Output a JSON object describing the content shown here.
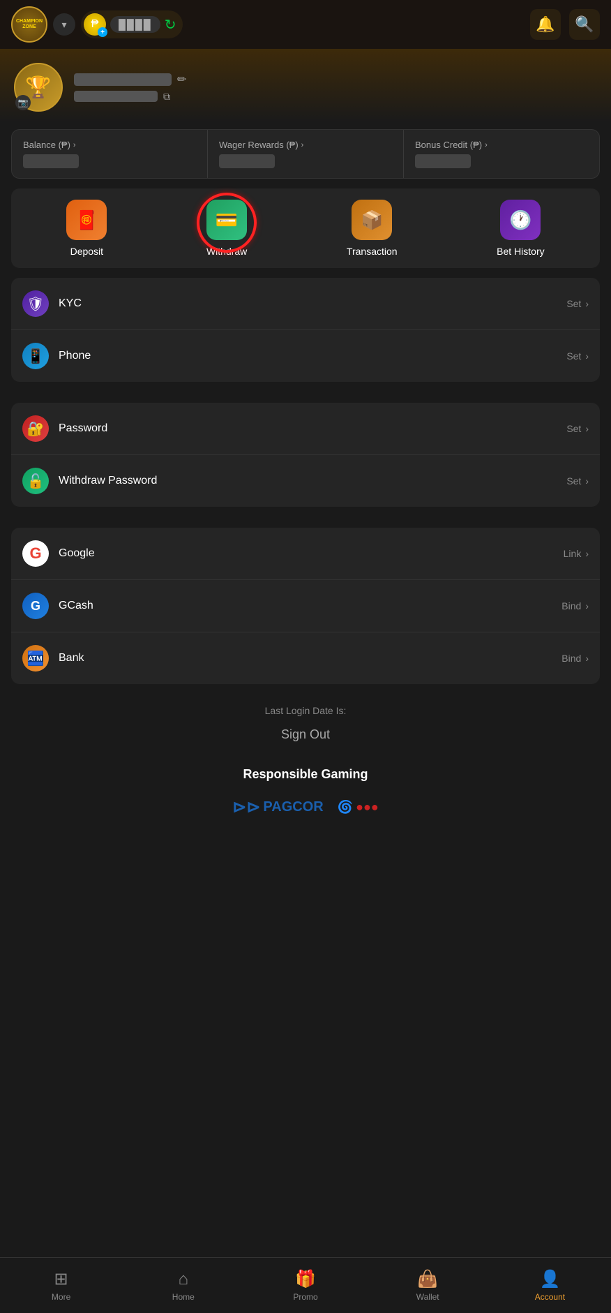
{
  "header": {
    "dropdown_label": "▾",
    "balance_placeholder": "████",
    "refresh_label": "↻",
    "notification_label": "🔔",
    "search_label": "🔍"
  },
  "profile": {
    "username_hidden": true,
    "uid_hidden": true,
    "edit_icon": "✏",
    "copy_icon": "⧉"
  },
  "balance": {
    "cards": [
      {
        "label": "Balance (₱)",
        "amount_hidden": true
      },
      {
        "label": "Wager Rewards (₱)",
        "amount_hidden": true
      },
      {
        "label": "Bonus Credit (₱)",
        "amount_hidden": true
      }
    ]
  },
  "actions": [
    {
      "id": "deposit",
      "label": "Deposit",
      "icon": "🧧"
    },
    {
      "id": "withdraw",
      "label": "Withdraw",
      "icon": "💳"
    },
    {
      "id": "transaction",
      "label": "Transaction",
      "icon": "📦"
    },
    {
      "id": "bet-history",
      "label": "Bet History",
      "icon": "🕐"
    }
  ],
  "menu_groups": [
    {
      "items": [
        {
          "id": "kyc",
          "label": "KYC",
          "action": "Set",
          "icon_class": "menu-icon-kyc",
          "icon": "🛡"
        },
        {
          "id": "phone",
          "label": "Phone",
          "action": "Set",
          "icon_class": "menu-icon-phone",
          "icon": "📱"
        }
      ]
    },
    {
      "items": [
        {
          "id": "password",
          "label": "Password",
          "action": "Set",
          "icon_class": "menu-icon-password",
          "icon": "🔐"
        },
        {
          "id": "withdraw-password",
          "label": "Withdraw Password",
          "action": "Set",
          "icon_class": "menu-icon-withdrawpwd",
          "icon": "🔓"
        }
      ]
    },
    {
      "items": [
        {
          "id": "google",
          "label": "Google",
          "action": "Link",
          "icon_class": "menu-icon-google",
          "icon": "G"
        },
        {
          "id": "gcash",
          "label": "GCash",
          "action": "Bind",
          "icon_class": "menu-icon-gcash",
          "icon": "G"
        },
        {
          "id": "bank",
          "label": "Bank",
          "action": "Bind",
          "icon_class": "menu-icon-bank",
          "icon": "🏧"
        }
      ]
    }
  ],
  "last_login_label": "Last Login Date Is:",
  "sign_out_label": "Sign Out",
  "responsible_gaming": {
    "title": "Responsible Gaming",
    "partner1_text": "PAGCOR",
    "partner2_text": "●●●"
  },
  "bottom_nav": {
    "items": [
      {
        "id": "more",
        "label": "More",
        "icon": "⊞"
      },
      {
        "id": "home",
        "label": "Home",
        "icon": "⌂"
      },
      {
        "id": "promo",
        "label": "Promo",
        "icon": "🎁"
      },
      {
        "id": "wallet",
        "label": "Wallet",
        "icon": "👜"
      },
      {
        "id": "account",
        "label": "Account",
        "icon": "👤",
        "active": true
      }
    ]
  }
}
